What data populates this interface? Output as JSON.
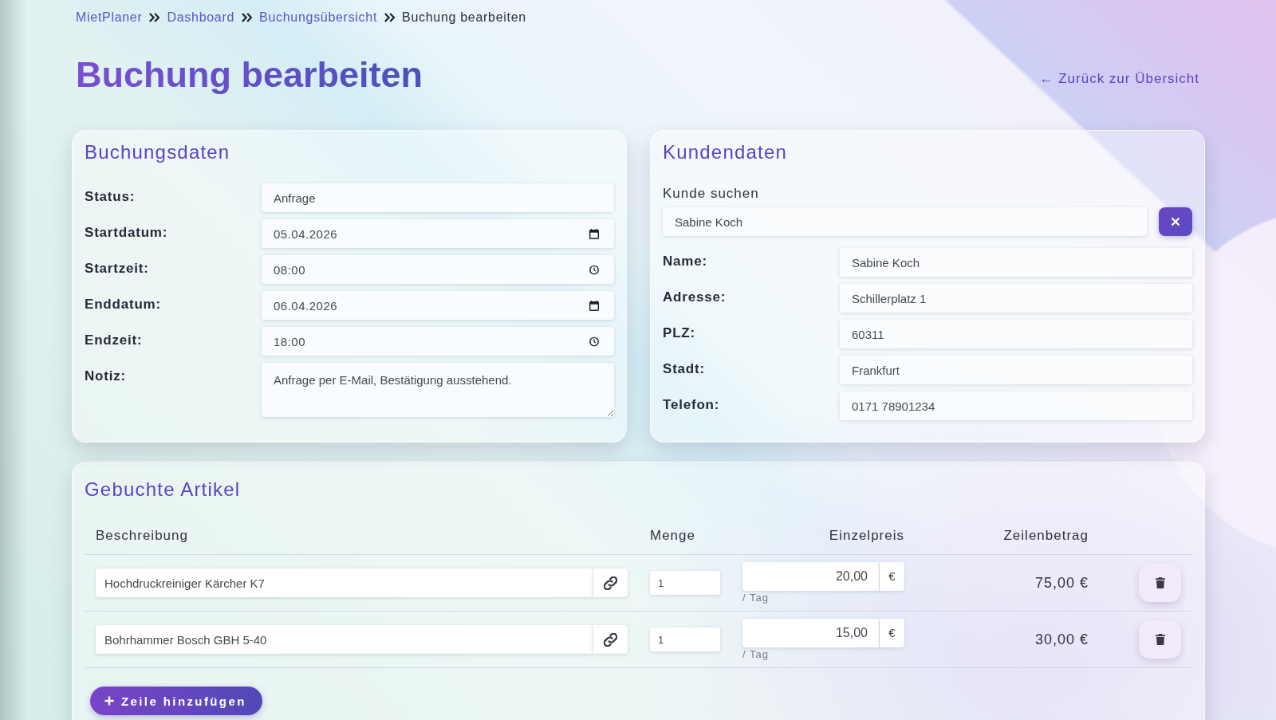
{
  "breadcrumb": [
    {
      "label": "MietPlaner",
      "current": false
    },
    {
      "label": "Dashboard",
      "current": false
    },
    {
      "label": "Buchungsübersicht",
      "current": false
    },
    {
      "label": "Buchung bearbeiten",
      "current": true
    }
  ],
  "page": {
    "title": "Buchung bearbeiten",
    "back_link": "← Zurück zur Übersicht"
  },
  "booking": {
    "title": "Buchungsdaten",
    "fields": [
      {
        "label": "Status:",
        "value": "Anfrage",
        "kind": "text"
      },
      {
        "label": "Startdatum:",
        "value": "05.04.2026",
        "kind": "date"
      },
      {
        "label": "Startzeit:",
        "value": "08:00",
        "kind": "time"
      },
      {
        "label": "Enddatum:",
        "value": "06.04.2026",
        "kind": "date"
      },
      {
        "label": "Endzeit:",
        "value": "18:00",
        "kind": "time"
      },
      {
        "label": "Notiz:",
        "value": "Anfrage per E-Mail, Bestätigung ausstehend.",
        "kind": "textarea"
      }
    ]
  },
  "customer": {
    "title": "Kundendaten",
    "search": {
      "label": "Kunde suchen",
      "value": "Sabine Koch"
    },
    "fields": [
      {
        "label": "Name:",
        "value": "Sabine Koch"
      },
      {
        "label": "Adresse:",
        "value": "Schillerplatz 1"
      },
      {
        "label": "PLZ:",
        "value": "60311"
      },
      {
        "label": "Stadt:",
        "value": "Frankfurt"
      },
      {
        "label": "Telefon:",
        "value": "0171 78901234"
      }
    ]
  },
  "items": {
    "title": "Gebuchte Artikel",
    "columns": [
      "Beschreibung",
      "Menge",
      "Einzelpreis",
      "Zeilenbetrag"
    ],
    "rows": [
      {
        "description": "Hochdruckreiniger Kärcher K7",
        "quantity": "1",
        "unit_price": "20,00",
        "currency": "€",
        "unit": "/ Tag",
        "line_total": "75,00 €"
      },
      {
        "description": "Bohrhammer Bosch GBH 5-40",
        "quantity": "1",
        "unit_price": "15,00",
        "currency": "€",
        "unit": "/ Tag",
        "line_total": "30,00 €"
      }
    ],
    "add_button": "Zeile hinzufügen"
  }
}
